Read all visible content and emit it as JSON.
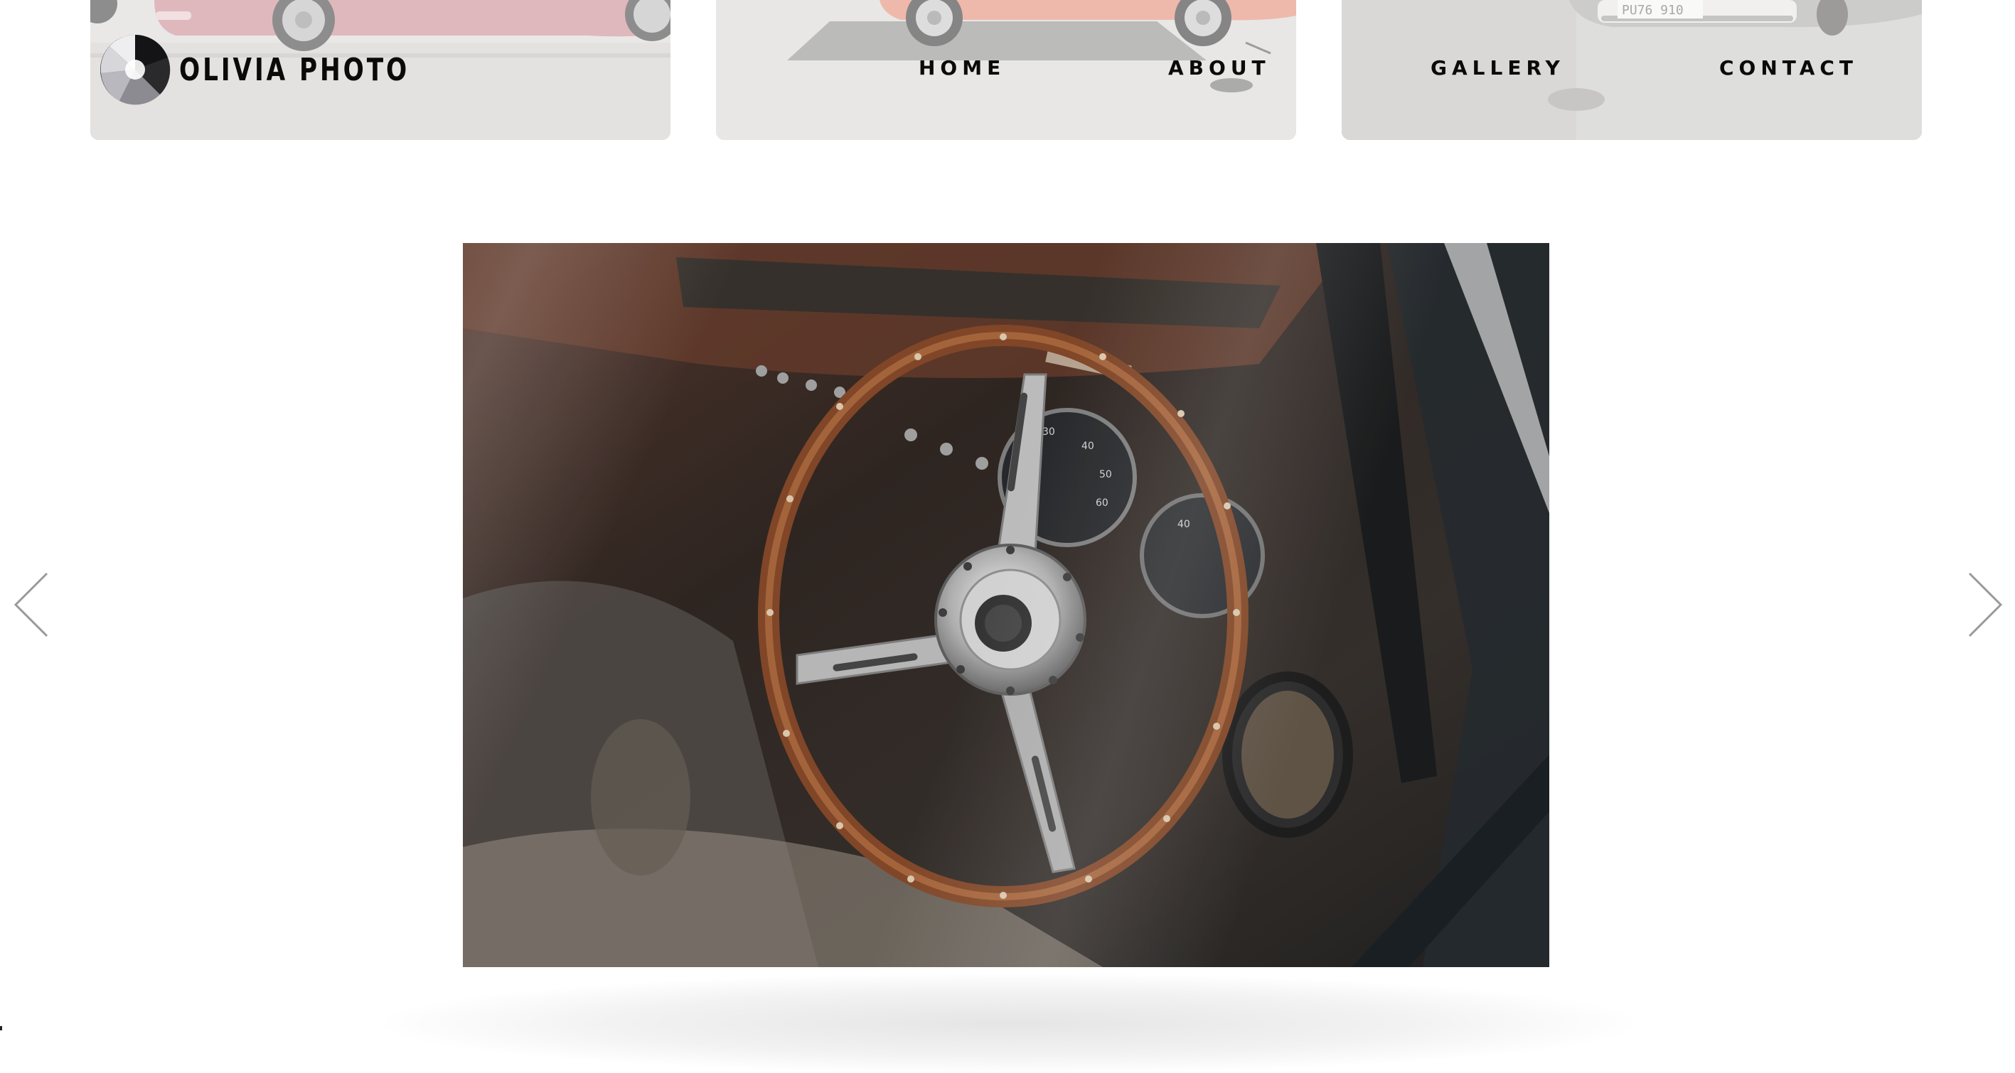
{
  "site": {
    "logo_text": "OLIVIA PHOTO",
    "logo_icon": "camera-shutter-icon"
  },
  "nav": {
    "items": [
      {
        "label": "HOME"
      },
      {
        "label": "ABOUT"
      },
      {
        "label": "GALLERY"
      },
      {
        "label": "CONTACT"
      }
    ]
  },
  "header_tiles": [
    {
      "subject": "red classic car front"
    },
    {
      "subject": "red classic car rear on pavement"
    },
    {
      "subject": "classic car bumper with license plate",
      "plate_text": "PU76 910"
    }
  ],
  "slideshow": {
    "current_image_subject": "wooden steering wheel of a vintage car seen through window",
    "prev_icon": "chevron-left-icon",
    "next_icon": "chevron-right-icon"
  },
  "colors": {
    "text": "#0a0a0a",
    "background": "#ffffff",
    "arrow": "#9a9a9a"
  }
}
